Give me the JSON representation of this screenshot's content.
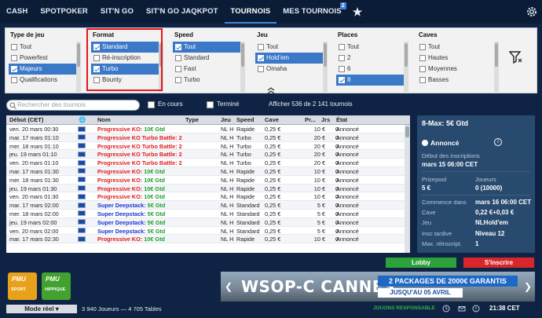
{
  "nav": {
    "tabs": [
      "CASH",
      "SPOTPOKER",
      "SIT'N GO",
      "SIT'N GO JAQKPOT",
      "TOURNOIS",
      "MES TOURNOIS"
    ],
    "badge": "2",
    "active": "TOURNOIS"
  },
  "filters": {
    "type": {
      "title": "Type de jeu",
      "items": [
        "Tout",
        "Powerfest",
        "Majeurs",
        "Qualifications"
      ],
      "sel": [
        false,
        false,
        true,
        false
      ]
    },
    "format": {
      "title": "Format",
      "items": [
        "Standard",
        "Ré-inscription",
        "Turbo",
        "Bounty"
      ],
      "sel": [
        true,
        false,
        true,
        false
      ]
    },
    "speed": {
      "title": "Speed",
      "items": [
        "Tout",
        "Standard",
        "Fast",
        "Turbo"
      ],
      "sel": [
        true,
        false,
        false,
        false
      ]
    },
    "jeu": {
      "title": "Jeu",
      "items": [
        "Tout",
        "Hold'em",
        "Omaha"
      ],
      "sel": [
        false,
        true,
        false
      ]
    },
    "places": {
      "title": "Places",
      "items": [
        "Tout",
        "2",
        "6",
        "8"
      ],
      "sel": [
        false,
        false,
        false,
        true
      ]
    },
    "caves": {
      "title": "Caves",
      "items": [
        "Tout",
        "Hautes",
        "Moyennes",
        "Basses"
      ],
      "sel": [
        false,
        false,
        false,
        false
      ]
    }
  },
  "search": {
    "placeholder": "Rechercher des tournois",
    "en_cours": "En cours",
    "termine": "Terminé",
    "count": "Afficher 536 de 2 141 tournois"
  },
  "table": {
    "headers": [
      "Début (CET)",
      "Nom",
      "Type",
      "Jeu",
      "Speed",
      "Cave",
      "Pr...",
      "Jrs",
      "État"
    ],
    "rows": [
      [
        "ven. 20 mars 00:30",
        "Progressive KO: 10€ Gtd",
        "red",
        "NL H",
        "Rapide",
        "0,25 €",
        "10 €",
        "0",
        "Annoncé"
      ],
      [
        "mar. 17 mars 01:10",
        "Progressive KO Turbo Battle: 2",
        "red",
        "NL H",
        "Turbo",
        "0,25 €",
        "20 €",
        "0",
        "Annoncé"
      ],
      [
        "mer. 18 mars 01:10",
        "Progressive KO Turbo Battle: 2",
        "red",
        "NL H",
        "Turbo",
        "0,25 €",
        "20 €",
        "0",
        "Annoncé"
      ],
      [
        "jeu. 19 mars 01:10",
        "Progressive KO Turbo Battle: 2",
        "red",
        "NL H",
        "Turbo",
        "0,25 €",
        "20 €",
        "0",
        "Annoncé"
      ],
      [
        "ven. 20 mars 01:10",
        "Progressive KO Turbo Battle: 2",
        "red",
        "NL H",
        "Turbo",
        "0,25 €",
        "20 €",
        "0",
        "Annoncé"
      ],
      [
        "mar. 17 mars 01:30",
        "Progressive KO: 10€ Gtd",
        "red",
        "NL H",
        "Rapide",
        "0,25 €",
        "10 €",
        "0",
        "Annoncé"
      ],
      [
        "mer. 18 mars 01:30",
        "Progressive KO: 10€ Gtd",
        "red",
        "NL H",
        "Rapide",
        "0,25 €",
        "10 €",
        "0",
        "Annoncé"
      ],
      [
        "jeu. 19 mars 01:30",
        "Progressive KO: 10€ Gtd",
        "red",
        "NL H",
        "Rapide",
        "0,25 €",
        "10 €",
        "0",
        "Annoncé"
      ],
      [
        "ven. 20 mars 01:30",
        "Progressive KO: 10€ Gtd",
        "red",
        "NL H",
        "Rapide",
        "0,25 €",
        "10 €",
        "0",
        "Annoncé"
      ],
      [
        "mar. 17 mars 02:00",
        "Super Deepstack: 5€ Gtd",
        "blue",
        "NL H",
        "Standard",
        "0,25 €",
        "5 €",
        "0",
        "Annoncé"
      ],
      [
        "mer. 18 mars 02:00",
        "Super Deepstack: 5€ Gtd",
        "blue",
        "NL H",
        "Standard",
        "0,25 €",
        "5 €",
        "0",
        "Annoncé"
      ],
      [
        "jeu. 19 mars 02:00",
        "Super Deepstack: 5€ Gtd",
        "blue",
        "NL H",
        "Standard",
        "0,25 €",
        "5 €",
        "0",
        "Annoncé"
      ],
      [
        "ven. 20 mars 02:00",
        "Super Deepstack: 5€ Gtd",
        "blue",
        "NL H",
        "Standard",
        "0,25 €",
        "5 €",
        "0",
        "Annoncé"
      ],
      [
        "mar. 17 mars 02:30",
        "Progressive KO: 10€ Gtd",
        "red",
        "NL H",
        "Rapide",
        "0,25 €",
        "10 €",
        "0",
        "Annoncé"
      ]
    ]
  },
  "detail": {
    "title": "8-Max: 5€ Gtd",
    "status": "Annoncé",
    "debut_label": "Début des inscriptions",
    "debut": "mars 15 06:00 CET",
    "prize_label": "Prizepool",
    "prize": "5 €",
    "joueurs_label": "Joueurs",
    "joueurs": "0 (10000)",
    "commence_label": "Commence dans",
    "commence": "mars 16 06:00 CET",
    "cave_label": "Cave",
    "cave": "0,22 €+0,03 €",
    "jeu_label": "Jeu",
    "jeu": "NLHold'em",
    "insc_label": "Insc tardive",
    "insc": "Niveau 12",
    "max_label": "Max. réinscript.",
    "max": "1"
  },
  "buttons": {
    "lobby": "Lobby",
    "inscrire": "S'inscrire"
  },
  "bottom": {
    "mode": "Mode réel",
    "joueurs": "3 940 Joueurs",
    "tables": "4 705 Tables",
    "clock": "21:38 CET",
    "jr": "JOUONS RESPONSABLE",
    "pmu": "PMU",
    "sport": "SPORT",
    "hippique": "HIPPIQUE"
  },
  "banner": {
    "main": "WSOP-C CANNES",
    "line1": "2 PACKAGES DE 2000€ GARANTIS",
    "line2": "JUSQU'AU 05 AVRIL"
  }
}
